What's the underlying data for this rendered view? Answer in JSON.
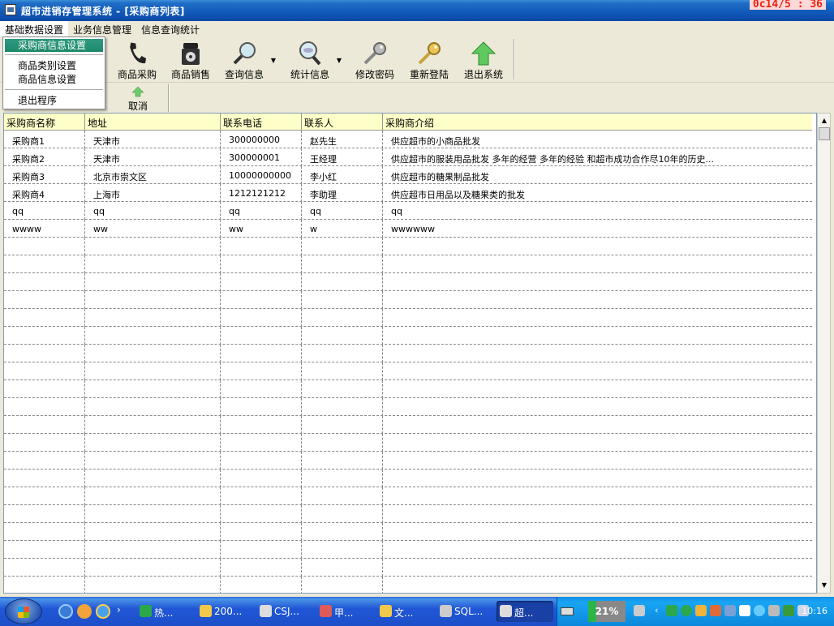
{
  "window": {
    "title": "超市进销存管理系统 - [采购商列表]",
    "clock": "0c14/5 : 36"
  },
  "menubar": [
    "基础数据设置",
    "业务信息管理",
    "信息查询统计"
  ],
  "dropdown": {
    "items": [
      "采购商信息设置",
      "商品类别设置",
      "商品信息设置",
      "退出程序"
    ]
  },
  "toolbar": {
    "buttons": [
      {
        "label": "商品采购",
        "icon": "phone-icon"
      },
      {
        "label": "商品销售",
        "icon": "telephone-icon"
      },
      {
        "label": "查询信息",
        "icon": "magnifier-icon"
      },
      {
        "label": "统计信息",
        "icon": "magnifier-stats-icon"
      },
      {
        "label": "修改密码",
        "icon": "key-icon"
      },
      {
        "label": "重新登陆",
        "icon": "gold-key-icon"
      },
      {
        "label": "退出系统",
        "icon": "up-arrow-icon"
      }
    ]
  },
  "toolbar2": {
    "cancel_label": "取消"
  },
  "grid": {
    "columns": [
      "采购商名称",
      "地址",
      "联系电话",
      "联系人",
      "采购商介绍"
    ],
    "rows": [
      [
        "采购商1",
        "天津市",
        "300000000",
        "赵先生",
        "供应超市的小商品批发"
      ],
      [
        "采购商2",
        "天津市",
        "300000001",
        "王经理",
        "供应超市的服装用品批发 多年的经营 多年的经验  和超市成功合作尽10年的历史..."
      ],
      [
        "采购商3",
        "北京市崇文区",
        "10000000000",
        "李小红",
        "供应超市的糖果制品批发"
      ],
      [
        "采购商4",
        "上海市",
        "1212121212",
        "李助理",
        "供应超市日用品以及糖果类的批发"
      ],
      [
        "qq",
        "qq",
        "qq",
        "qq",
        "qq"
      ],
      [
        "wwww",
        "ww",
        "ww",
        "w",
        "wwwwww"
      ]
    ]
  },
  "taskbar": {
    "tasks": [
      "热...",
      "200...",
      "CSJ...",
      "甲...",
      "文...",
      "SQL...",
      "超..."
    ],
    "battery_percent": "21%",
    "battery_level": 0.21,
    "time": "10:16"
  }
}
